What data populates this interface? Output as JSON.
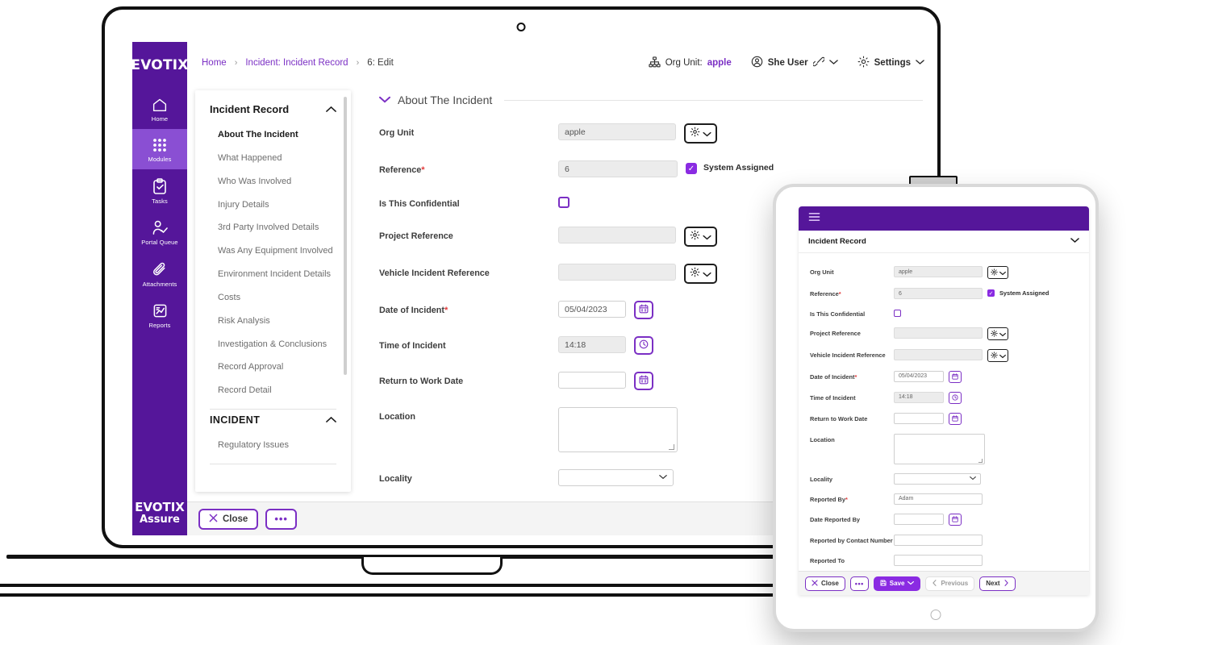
{
  "brand": {
    "logo": "EVOTIX",
    "foot_top": "EVOTIX",
    "foot_bottom": "Assure"
  },
  "colors": {
    "rail_purple": "#55169A",
    "rail_active": "#8A4FD3",
    "accent_purple": "#7B2FC4",
    "primary_purple": "#8A2BE2",
    "required_red": "#e23b3b"
  },
  "navrail": {
    "items": [
      {
        "label": "Home",
        "icon": "home-icon",
        "active": false
      },
      {
        "label": "Modules",
        "icon": "grid-icon",
        "active": true
      },
      {
        "label": "Tasks",
        "icon": "clipboard-icon",
        "active": false
      },
      {
        "label": "Portal Queue",
        "icon": "user-check-icon",
        "active": false
      },
      {
        "label": "Attachments",
        "icon": "paperclip-icon",
        "active": false
      },
      {
        "label": "Reports",
        "icon": "chart-report-icon",
        "active": false
      }
    ]
  },
  "topbar": {
    "breadcrumbs": [
      {
        "label": "Home",
        "link": true
      },
      {
        "label": "Incident: Incident Record",
        "link": true
      },
      {
        "label": "6: Edit",
        "link": false
      }
    ],
    "separator": "›",
    "org_unit_label": "Org Unit:",
    "org_unit_value": "apple",
    "user_name": "She User",
    "settings_label": "Settings"
  },
  "secnav": {
    "group1_title": "Incident Record",
    "group1_items": [
      {
        "label": "About The Incident",
        "current": true
      },
      {
        "label": "What Happened",
        "current": false
      },
      {
        "label": "Who Was Involved",
        "current": false
      },
      {
        "label": "Injury Details",
        "current": false
      },
      {
        "label": "3rd Party Involved Details",
        "current": false
      },
      {
        "label": "Was Any Equipment Involved",
        "current": false
      },
      {
        "label": "Environment Incident Details",
        "current": false
      },
      {
        "label": "Costs",
        "current": false
      },
      {
        "label": "Risk Analysis",
        "current": false
      },
      {
        "label": "Investigation & Conclusions",
        "current": false
      },
      {
        "label": "Record Approval",
        "current": false
      },
      {
        "label": "Record Detail",
        "current": false
      }
    ],
    "group2_title": "INCIDENT",
    "group2_items": [
      {
        "label": "Regulatory Issues",
        "current": false
      }
    ]
  },
  "form": {
    "section_title": "About The Incident",
    "org_unit_label": "Org Unit",
    "org_unit_value": "apple",
    "reference_label": "Reference",
    "reference_value": "6",
    "system_assigned_label": "System Assigned",
    "confidential_label": "Is This Confidential",
    "project_reference_label": "Project Reference",
    "project_reference_value": "",
    "vehicle_reference_label": "Vehicle Incident Reference",
    "vehicle_reference_value": "",
    "date_of_incident_label": "Date of Incident",
    "date_of_incident_value": "05/04/2023",
    "time_of_incident_label": "Time of Incident",
    "time_of_incident_value": "14:18",
    "return_to_work_label": "Return to Work Date",
    "return_to_work_value": "",
    "location_label": "Location",
    "location_value": "",
    "locality_label": "Locality",
    "locality_value": "",
    "reported_by_label": "Reported By",
    "reported_by_value": "Adam",
    "date_reported_by_label": "Date Reported By",
    "date_reported_by_value": "",
    "contact_number_label": "Reported by Contact Number",
    "contact_number_value": "",
    "reported_to_label": "Reported To",
    "reported_to_value": "",
    "required_marker": "*"
  },
  "actionbar": {
    "close_label": "Close",
    "more_label": "•••",
    "save_label": "Save"
  },
  "tablet": {
    "menu_icon": "hamburger-icon",
    "record_title": "Incident Record",
    "actionbar": {
      "close_label": "Close",
      "more_label": "•••",
      "save_label": "Save",
      "previous_label": "Previous",
      "next_label": "Next"
    }
  }
}
